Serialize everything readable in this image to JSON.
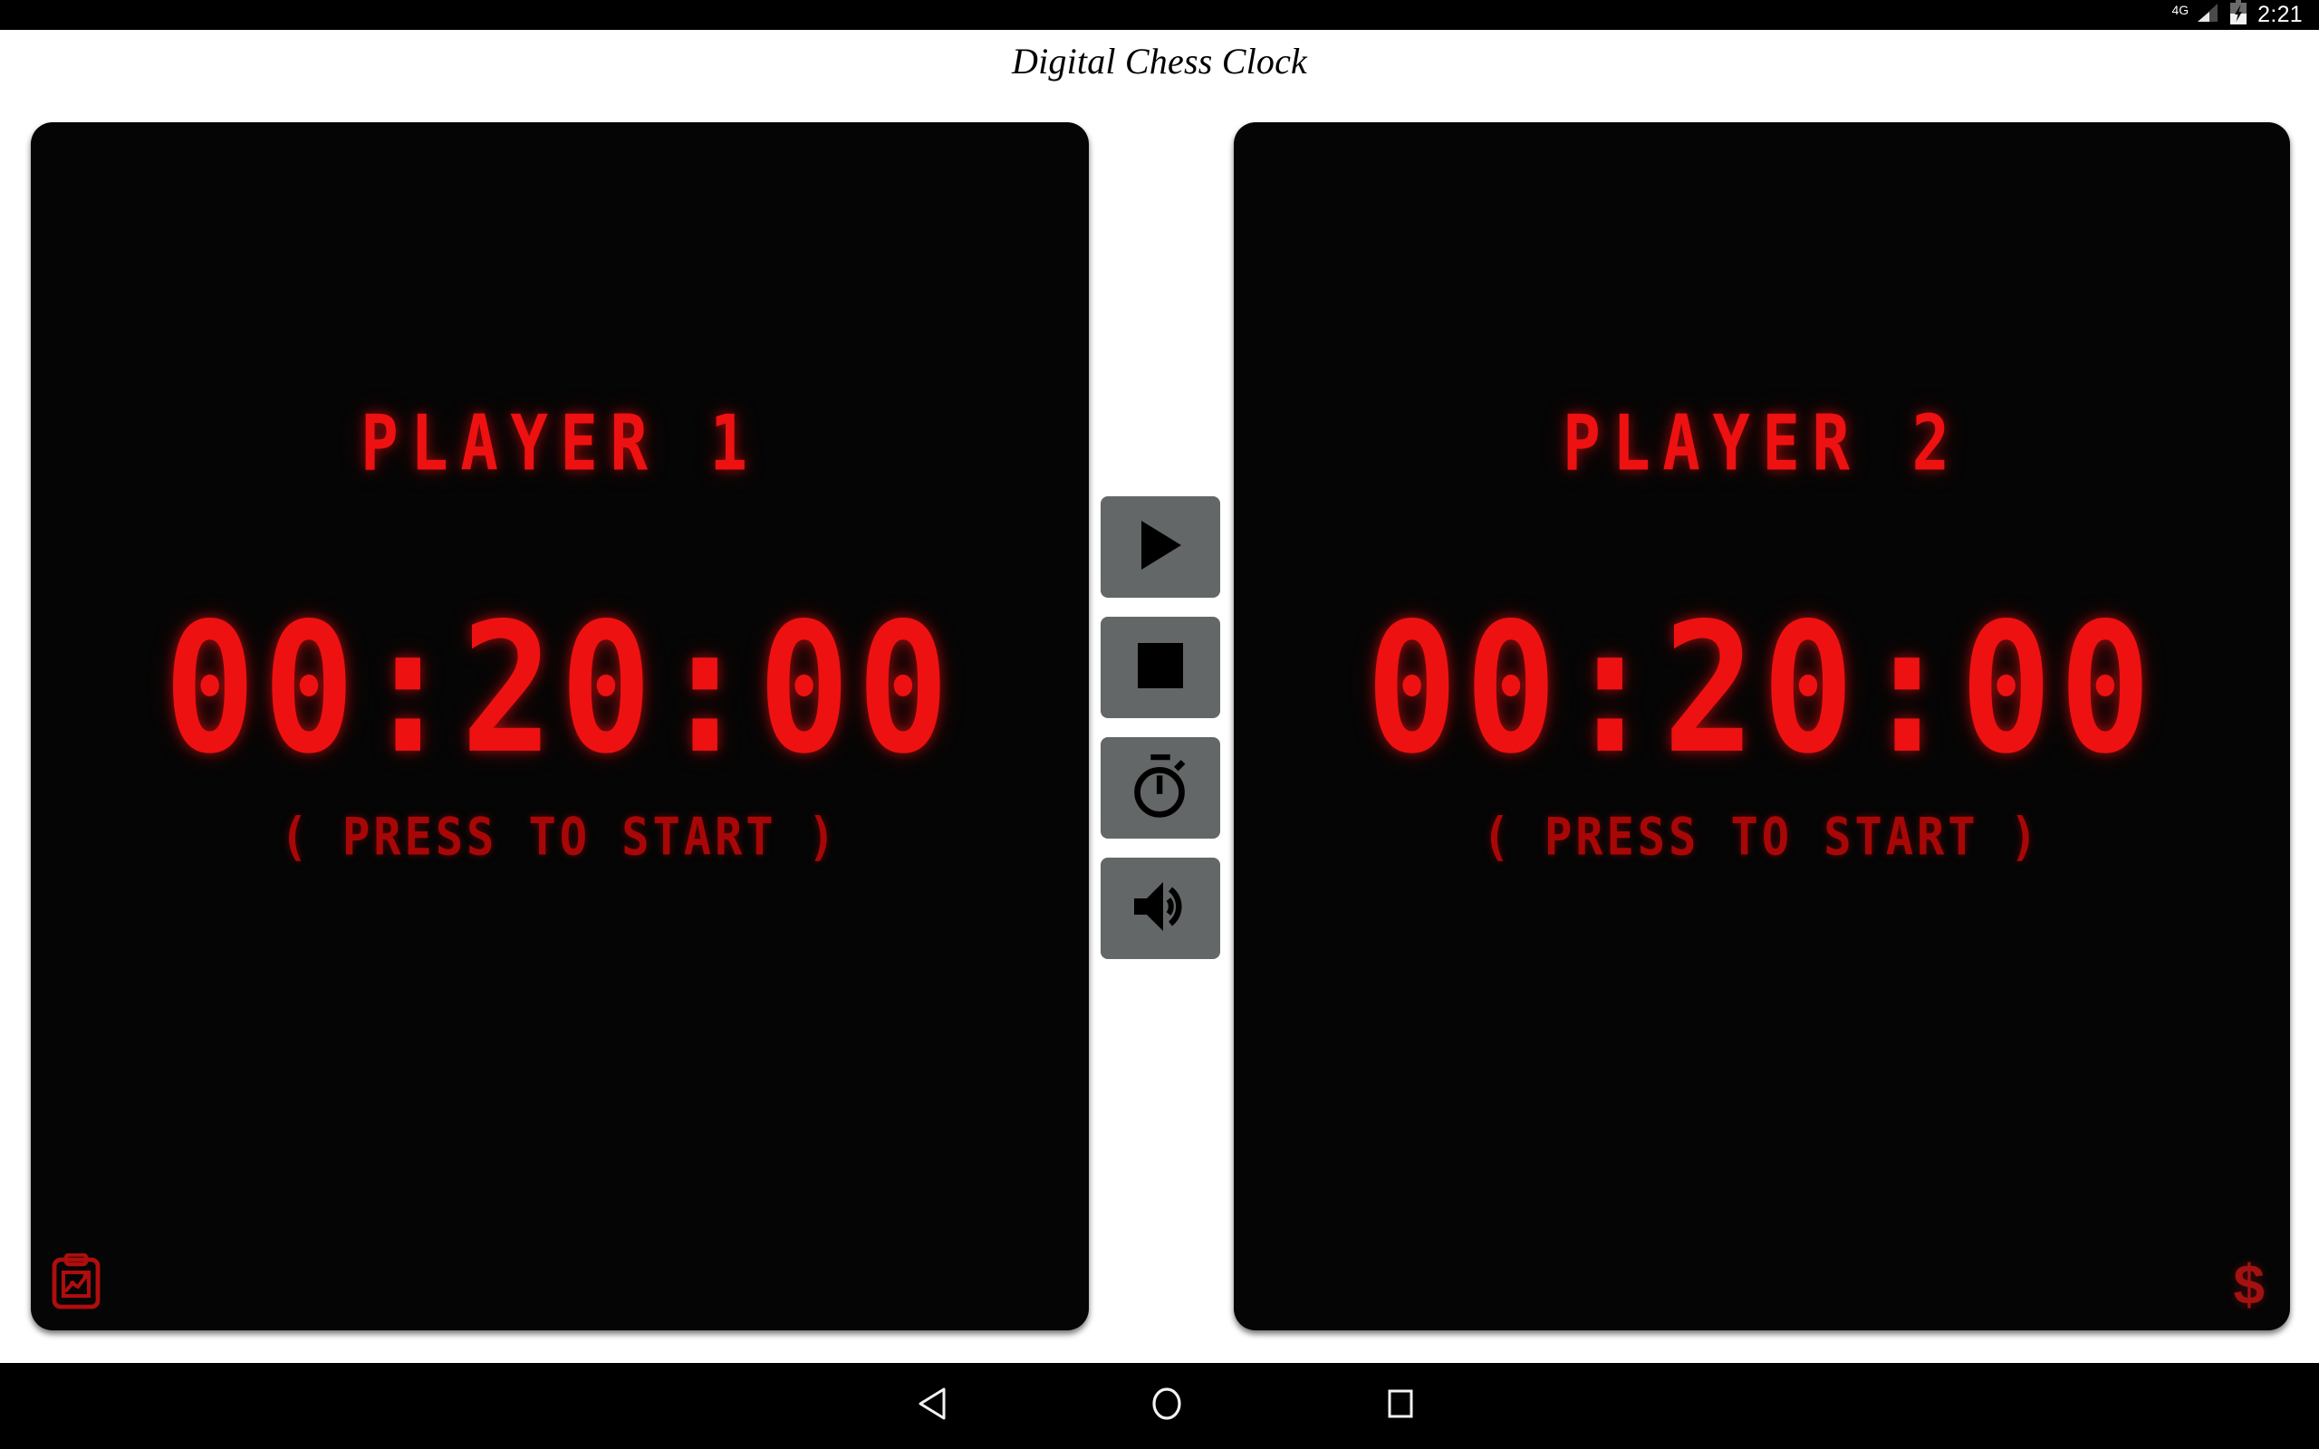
{
  "status_bar": {
    "network_label": "4G",
    "signal_icon": "signal-bars-icon",
    "battery_icon": "battery-charging-icon",
    "clock": "2:21"
  },
  "header": {
    "title": "Digital Chess Clock"
  },
  "players": [
    {
      "name": "PLAYER 1",
      "time": "00:20:00",
      "hint": "( PRESS TO START )",
      "corner_icon": "scoresheet-clipboard-icon",
      "corner_side": "left"
    },
    {
      "name": "PLAYER 2",
      "time": "00:20:00",
      "hint": "( PRESS TO START )",
      "corner_icon": "dollar-sign-icon",
      "corner_glyph": "$",
      "corner_side": "right"
    }
  ],
  "controls": [
    {
      "name": "play-button",
      "icon": "play-icon",
      "label": "Play"
    },
    {
      "name": "stop-button",
      "icon": "stop-icon",
      "label": "Stop"
    },
    {
      "name": "timer-button",
      "icon": "stopwatch-icon",
      "label": "Timer settings"
    },
    {
      "name": "sound-button",
      "icon": "volume-icon",
      "label": "Sound"
    }
  ],
  "nav_bar": {
    "back": "back-triangle-icon",
    "home": "home-circle-icon",
    "recents": "recents-square-icon"
  },
  "colors": {
    "led_bright_red": "#ee1111",
    "led_dim_red": "#a80707",
    "panel_black": "#050505",
    "button_gray": "#646767",
    "page_white": "#ffffff",
    "system_black": "#000000"
  }
}
